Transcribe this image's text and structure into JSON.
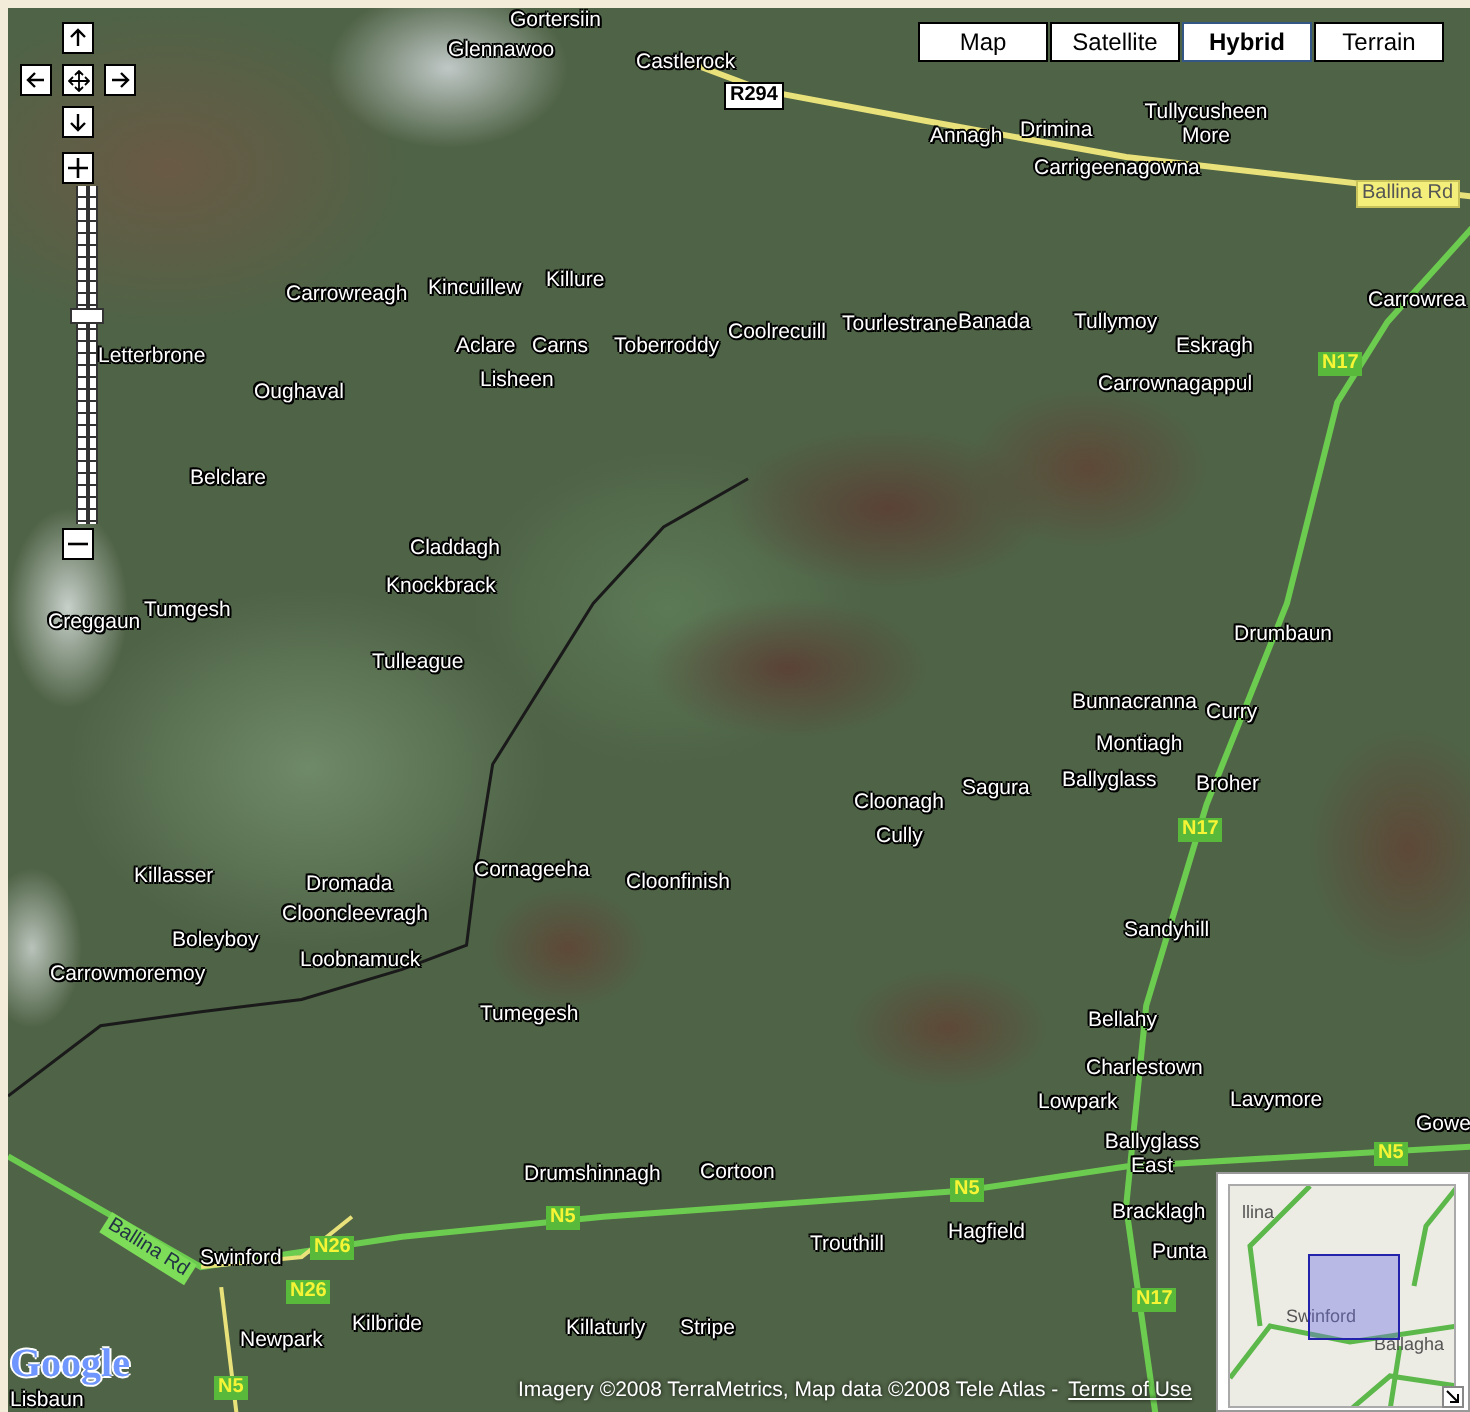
{
  "map_types": [
    {
      "label": "Map",
      "selected": false
    },
    {
      "label": "Satellite",
      "selected": false
    },
    {
      "label": "Hybrid",
      "selected": true
    },
    {
      "label": "Terrain",
      "selected": false
    }
  ],
  "zoom_slider": {
    "level": 0.62
  },
  "places": [
    {
      "name": "Gortersiin"
    },
    {
      "name": "Glennawoo"
    },
    {
      "name": "Castlerock"
    },
    {
      "name": "Annagh"
    },
    {
      "name": "Drimina"
    },
    {
      "name": "Tullycusheen More"
    },
    {
      "name": "Carrigeenagowna"
    },
    {
      "name": "Carrowrea"
    },
    {
      "name": "Carrowreagh"
    },
    {
      "name": "Kincuillew"
    },
    {
      "name": "Killure"
    },
    {
      "name": "Aclare"
    },
    {
      "name": "Carns"
    },
    {
      "name": "Toberroddy"
    },
    {
      "name": "Coolrecuill"
    },
    {
      "name": "Tourlestrane"
    },
    {
      "name": "Banada"
    },
    {
      "name": "Tullymoy"
    },
    {
      "name": "Eskragh"
    },
    {
      "name": "Carrownagappul"
    },
    {
      "name": "Letterbrone"
    },
    {
      "name": "Oughaval"
    },
    {
      "name": "Lisheen"
    },
    {
      "name": "Belclare"
    },
    {
      "name": "Creggaun"
    },
    {
      "name": "Tumgesh"
    },
    {
      "name": "Claddagh"
    },
    {
      "name": "Knockbrack"
    },
    {
      "name": "Tulleague"
    },
    {
      "name": "Drumbaun"
    },
    {
      "name": "Bunnacranna"
    },
    {
      "name": "Curry"
    },
    {
      "name": "Montiagh"
    },
    {
      "name": "Sagura"
    },
    {
      "name": "Ballyglass"
    },
    {
      "name": "Broher"
    },
    {
      "name": "Cloonagh"
    },
    {
      "name": "Cully"
    },
    {
      "name": "Sandyhill"
    },
    {
      "name": "Killasser"
    },
    {
      "name": "Dromada"
    },
    {
      "name": "Cornageeha"
    },
    {
      "name": "Cloonfinish"
    },
    {
      "name": "Clooncleevragh"
    },
    {
      "name": "Boleyboy"
    },
    {
      "name": "Loobnamuck"
    },
    {
      "name": "Carrowmoremoy"
    },
    {
      "name": "Tumegesh"
    },
    {
      "name": "Bellahy"
    },
    {
      "name": "Charlestown"
    },
    {
      "name": "Lowpark"
    },
    {
      "name": "Lavymore"
    },
    {
      "name": "Gowe"
    },
    {
      "name": "Ballyglass East"
    },
    {
      "name": "Drumshinnagh"
    },
    {
      "name": "Cortoon"
    },
    {
      "name": "Bracklagh"
    },
    {
      "name": "Swinford"
    },
    {
      "name": "Trouthill"
    },
    {
      "name": "Hagfield"
    },
    {
      "name": "Punta"
    },
    {
      "name": "Kilbride"
    },
    {
      "name": "Newpark"
    },
    {
      "name": "Killaturly"
    },
    {
      "name": "Stripe"
    },
    {
      "name": "Lisbaun"
    }
  ],
  "road_shields": [
    {
      "label": "R294",
      "kind": "regional"
    },
    {
      "label": "Ballina Rd",
      "kind": "local"
    },
    {
      "label": "N17",
      "kind": "national"
    },
    {
      "label": "N17",
      "kind": "national"
    },
    {
      "label": "N5",
      "kind": "national"
    },
    {
      "label": "N5",
      "kind": "national"
    },
    {
      "label": "N5",
      "kind": "national"
    },
    {
      "label": "Ballina Rd",
      "kind": "trunk"
    },
    {
      "label": "N26",
      "kind": "national"
    },
    {
      "label": "N26",
      "kind": "national"
    },
    {
      "label": "N17",
      "kind": "national"
    },
    {
      "label": "N5",
      "kind": "national"
    }
  ],
  "logo": "Google",
  "copyright": {
    "text": "Imagery ©2008 TerraMetrics, Map data ©2008 Tele Atlas -",
    "link": "Terms of Use"
  },
  "overview": {
    "labels": [
      "llina",
      "Swinford",
      "Ballagha"
    ]
  }
}
